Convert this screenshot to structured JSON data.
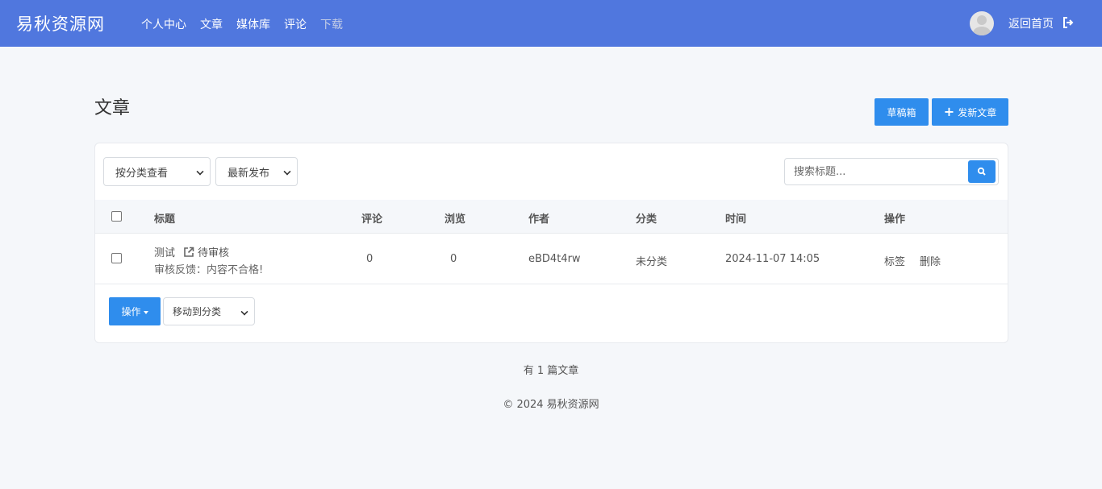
{
  "header": {
    "logo": "易秋资源网",
    "nav": [
      {
        "label": "个人中心"
      },
      {
        "label": "文章"
      },
      {
        "label": "媒体库"
      },
      {
        "label": "评论"
      },
      {
        "label": "下载"
      }
    ],
    "home_link": "返回首页"
  },
  "page": {
    "title": "文章",
    "drafts_button": "草稿箱",
    "new_post_button": "发新文章"
  },
  "filters": {
    "category_select": "按分类查看",
    "sort_select": "最新发布",
    "search_placeholder": "搜索标题..."
  },
  "table": {
    "columns": [
      "标题",
      "评论",
      "浏览",
      "作者",
      "分类",
      "时间",
      "操作"
    ],
    "rows": [
      {
        "title": "测试",
        "status": "待审核",
        "feedback": "审核反馈：内容不合格!",
        "comments": "0",
        "views": "0",
        "author": "eBD4t4rw",
        "category": "未分类",
        "time": "2024-11-07 14:05",
        "actions": [
          "标签",
          "删除"
        ]
      }
    ]
  },
  "bulk": {
    "operations_button": "操作",
    "move_select": "移动到分类"
  },
  "summary": "有 1 篇文章",
  "footer": "© 2024 易秋资源网",
  "colors": {
    "header_bg": "#5077de",
    "primary": "#2f8ded",
    "page_bg": "#f5f7fa"
  },
  "icons": [
    "avatar",
    "logout-icon",
    "plus-icon",
    "search-icon",
    "external-link-icon",
    "caret-down-icon"
  ]
}
